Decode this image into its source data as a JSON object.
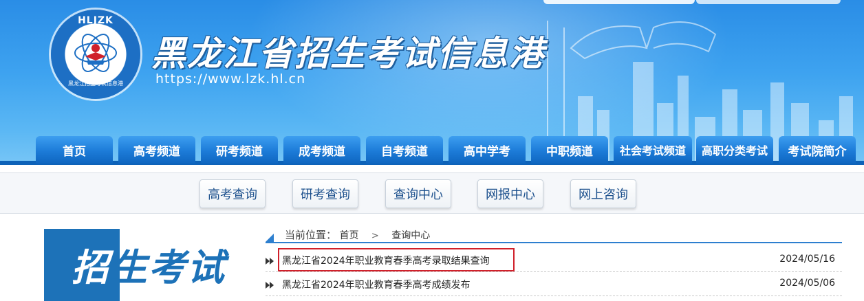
{
  "header": {
    "logo_top": "HLJZK",
    "logo_bottom": "黑龙江招生考试信息港",
    "title": "黑龙江省招生考试信息港",
    "url": "https://www.lzk.hl.cn"
  },
  "main_nav": [
    {
      "label": "首页"
    },
    {
      "label": "高考频道"
    },
    {
      "label": "研考频道"
    },
    {
      "label": "成考频道"
    },
    {
      "label": "自考频道"
    },
    {
      "label": "高中学考"
    },
    {
      "label": "中职频道"
    },
    {
      "label": "社会考试频道"
    },
    {
      "label": "高职分类考试"
    },
    {
      "label": "考试院简介"
    }
  ],
  "sub_nav": [
    {
      "label": "高考查询"
    },
    {
      "label": "研考查询"
    },
    {
      "label": "查询中心"
    },
    {
      "label": "网报中心"
    },
    {
      "label": "网上咨询"
    }
  ],
  "side_banner": {
    "text_white": "招",
    "text_blue": "生考试"
  },
  "breadcrumb": {
    "lead": "当前位置：",
    "items": [
      "首页",
      "查询中心"
    ],
    "separator": ">"
  },
  "news": [
    {
      "title": "黑龙江省2024年职业教育春季高考录取结果查询",
      "date": "2024/05/16"
    },
    {
      "title": "黑龙江省2024年职业教育春季高考成绩发布",
      "date": "2024/05/06"
    }
  ],
  "colors": {
    "banner": "#3ea3f0",
    "nav_blue": "#1c7bd8",
    "nav_line": "#0d62b8",
    "highlight": "#d0202a"
  }
}
